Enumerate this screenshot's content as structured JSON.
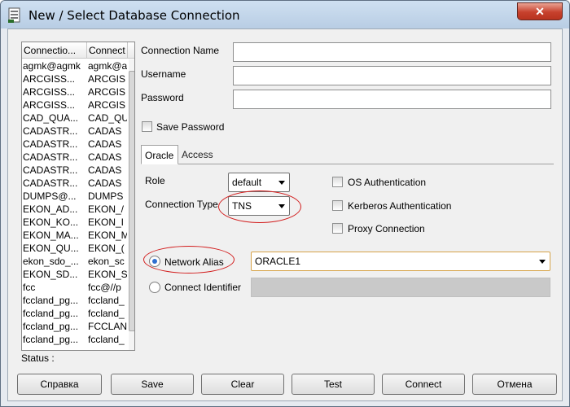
{
  "window": {
    "title": "New / Select Database Connection",
    "close_glyph": "✕"
  },
  "list": {
    "headers": [
      "Connectio...",
      "Connect"
    ],
    "rows": [
      [
        "agmk@agmk",
        "agmk@a"
      ],
      [
        "ARCGISS...",
        "ARCGIS"
      ],
      [
        "ARCGISS...",
        "ARCGIS"
      ],
      [
        "ARCGISS...",
        "ARCGIS"
      ],
      [
        "CAD_QUA...",
        "CAD_QU"
      ],
      [
        "CADASTR...",
        "CADAS"
      ],
      [
        "CADASTR...",
        "CADAS"
      ],
      [
        "CADASTR...",
        "CADAS"
      ],
      [
        "CADASTR...",
        "CADAS"
      ],
      [
        "CADASTR...",
        "CADAS"
      ],
      [
        "DUMPS@...",
        "DUMPS"
      ],
      [
        "EKON_AD...",
        "EKON_/"
      ],
      [
        "EKON_KO...",
        "EKON_I"
      ],
      [
        "EKON_MA...",
        "EKON_M"
      ],
      [
        "EKON_QU...",
        "EKON_("
      ],
      [
        "ekon_sdo_...",
        "ekon_sc"
      ],
      [
        "EKON_SD...",
        "EKON_S"
      ],
      [
        "fcc",
        "fcc@//p"
      ],
      [
        "fccland_pg...",
        "fccland_"
      ],
      [
        "fccland_pg...",
        "fccland_"
      ],
      [
        "fccland_pg...",
        "FCCLAN"
      ],
      [
        "fccland_pg...",
        "fccland_"
      ]
    ]
  },
  "status": {
    "label": "Status :"
  },
  "form": {
    "connection_name_label": "Connection Name",
    "username_label": "Username",
    "password_label": "Password",
    "connection_name_value": "",
    "username_value": "",
    "password_value": "",
    "save_password_label": "Save Password",
    "tabs": [
      "Oracle",
      "Access"
    ],
    "role_label": "Role",
    "role_value": "default",
    "connection_type_label": "Connection Type",
    "connection_type_value": "TNS",
    "os_auth_label": "OS Authentication",
    "kerberos_label": "Kerberos Authentication",
    "proxy_label": "Proxy Connection",
    "network_alias_label": "Network Alias",
    "network_alias_value": "ORACLE1",
    "connect_identifier_label": "Connect Identifier"
  },
  "buttons": {
    "help": "Справка",
    "save": "Save",
    "clear": "Clear",
    "test": "Test",
    "connect": "Connect",
    "cancel": "Отмена"
  },
  "colors": {
    "annotation": "#d21c1c",
    "radio_selected": "#2f6fd0"
  },
  "icons": {
    "app": "database-doc-icon",
    "close": "close-icon"
  }
}
